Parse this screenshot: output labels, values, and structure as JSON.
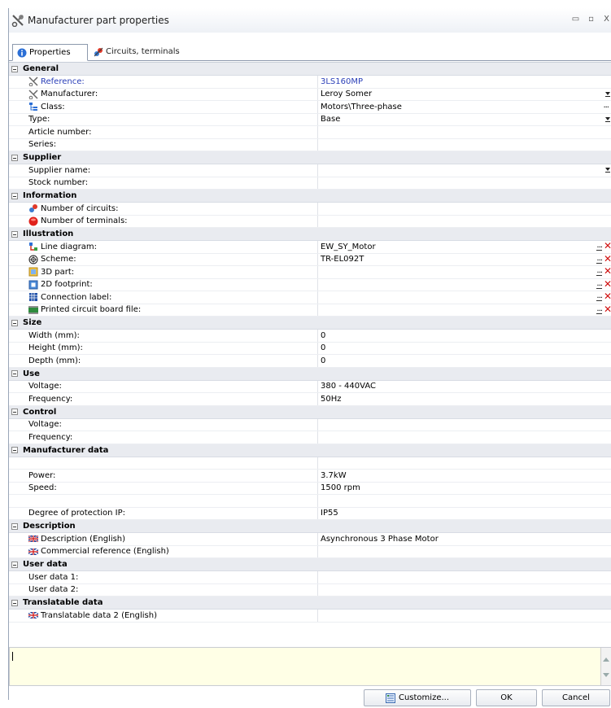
{
  "window": {
    "title": "Manufacturer part properties",
    "controls": [
      "▭",
      "▫",
      "X"
    ]
  },
  "tabs": [
    {
      "label": "Properties",
      "icon": "info-icon"
    },
    {
      "label": "Circuits, terminals",
      "icon": "circuits-icon"
    }
  ],
  "sections": {
    "general": {
      "label": "General",
      "reference": {
        "label": "Reference:",
        "value": "3LS160MP"
      },
      "manufacturer": {
        "label": "Manufacturer:",
        "value": "Leroy Somer"
      },
      "class": {
        "label": "Class:",
        "value": "Motors\\Three-phase"
      },
      "type": {
        "label": "Type:",
        "value": "Base"
      },
      "article": {
        "label": "Article number:",
        "value": ""
      },
      "series": {
        "label": "Series:",
        "value": ""
      }
    },
    "supplier": {
      "label": "Supplier",
      "name": {
        "label": "Supplier name:",
        "value": ""
      },
      "stock": {
        "label": "Stock number:",
        "value": ""
      }
    },
    "information": {
      "label": "Information",
      "circuits": {
        "label": "Number of circuits:",
        "value": ""
      },
      "terminals": {
        "label": "Number of terminals:",
        "value": ""
      }
    },
    "illustration": {
      "label": "Illustration",
      "line": {
        "label": "Line diagram:",
        "value": "EW_SY_Motor"
      },
      "scheme": {
        "label": "Scheme:",
        "value": "TR-EL092T"
      },
      "part3d": {
        "label": "3D part:",
        "value": ""
      },
      "footprint": {
        "label": "2D footprint:",
        "value": ""
      },
      "connection": {
        "label": "Connection label:",
        "value": ""
      },
      "pcb": {
        "label": "Printed circuit board file:",
        "value": ""
      }
    },
    "size": {
      "label": "Size",
      "width": {
        "label": "Width (mm):",
        "value": "0"
      },
      "height": {
        "label": "Height (mm):",
        "value": "0"
      },
      "depth": {
        "label": "Depth (mm):",
        "value": "0"
      }
    },
    "use": {
      "label": "Use",
      "voltage": {
        "label": "Voltage:",
        "value": "380 - 440VAC"
      },
      "frequency": {
        "label": "Frequency:",
        "value": "50Hz"
      }
    },
    "control": {
      "label": "Control",
      "voltage": {
        "label": "Voltage:",
        "value": ""
      },
      "frequency": {
        "label": "Frequency:",
        "value": ""
      }
    },
    "manufacturer_data": {
      "label": "Manufacturer data",
      "power": {
        "label": "Power:",
        "value": "3.7kW"
      },
      "speed": {
        "label": "Speed:",
        "value": "1500 rpm"
      },
      "ip": {
        "label": "Degree of protection IP:",
        "value": "IP55"
      }
    },
    "description": {
      "label": "Description",
      "desc": {
        "label": "Description (English)",
        "value": "Asynchronous 3 Phase Motor"
      },
      "commercial": {
        "label": "Commercial reference (English)",
        "value": ""
      }
    },
    "user_data": {
      "label": "User data",
      "d1": {
        "label": "User data 1:",
        "value": ""
      },
      "d2": {
        "label": "User data 2:",
        "value": ""
      }
    },
    "translatable": {
      "label": "Translatable data",
      "t2": {
        "label": "Translatable data 2 (English)",
        "value": ""
      }
    }
  },
  "buttons": {
    "dots": "...",
    "customize": "Customize...",
    "ok": "OK",
    "cancel": "Cancel"
  },
  "colors": {
    "reference_blue": "#2a3fb8",
    "section_bg": "#e9ebf0",
    "description_bg": "#ffffe6",
    "remove_red": "#d01010"
  }
}
